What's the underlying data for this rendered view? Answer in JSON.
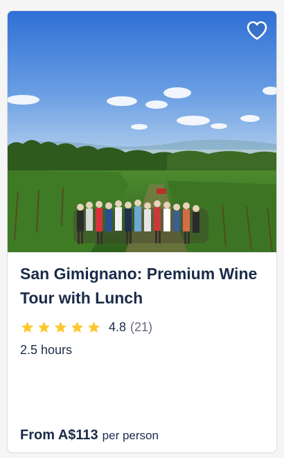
{
  "activity": {
    "title": "San Gimignano: Premium Wine Tour with Lunch",
    "rating_value": "4.8",
    "rating_count": "(21)",
    "rating_stars": 5,
    "duration": "2.5 hours",
    "price_label": "From A$113",
    "price_unit": "per person"
  },
  "icons": {
    "wishlist": "heart-outline-icon",
    "star": "star-filled-icon"
  },
  "colors": {
    "title_text": "#1a2b49",
    "muted_text": "#63687a",
    "star": "#fdc82f",
    "card_border": "#dcdcdc"
  }
}
